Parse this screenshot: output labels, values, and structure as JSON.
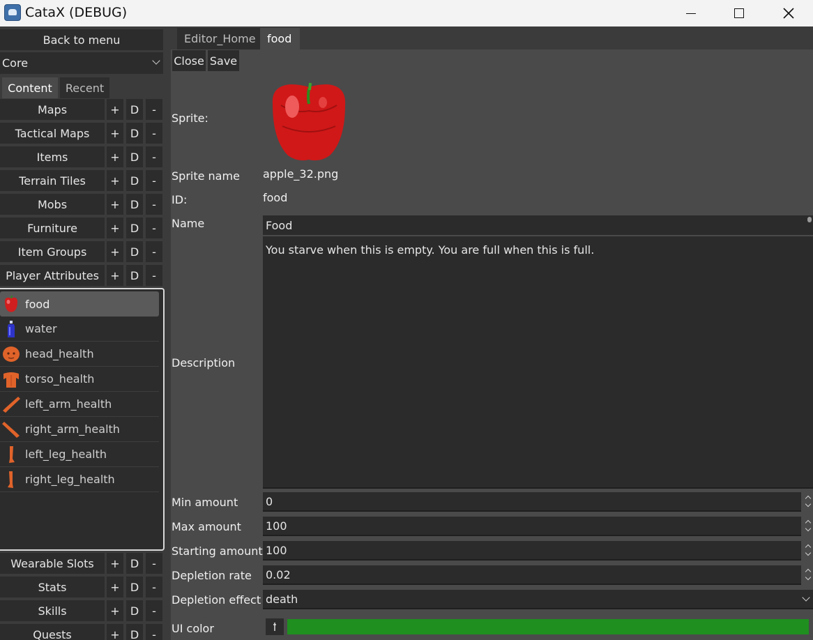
{
  "window": {
    "title": "CataX (DEBUG)"
  },
  "left": {
    "back_label": "Back to menu",
    "mod_select": "Core",
    "tabs": [
      {
        "label": "Content"
      },
      {
        "label": "Recent"
      }
    ],
    "categories_top": [
      {
        "label": "Maps"
      },
      {
        "label": "Tactical Maps"
      },
      {
        "label": "Items"
      },
      {
        "label": "Terrain Tiles"
      },
      {
        "label": "Mobs"
      },
      {
        "label": "Furniture"
      },
      {
        "label": "Item Groups"
      },
      {
        "label": "Player Attributes"
      }
    ],
    "action_labels": {
      "add": "+",
      "dup": "D",
      "del": "-"
    },
    "items": [
      {
        "label": "food",
        "icon": "apple-icon"
      },
      {
        "label": "water",
        "icon": "bottle-icon"
      },
      {
        "label": "head_health",
        "icon": "head-icon"
      },
      {
        "label": "torso_health",
        "icon": "torso-icon"
      },
      {
        "label": "left_arm_health",
        "icon": "arm-icon"
      },
      {
        "label": "right_arm_health",
        "icon": "arm-icon"
      },
      {
        "label": "left_leg_health",
        "icon": "leg-icon"
      },
      {
        "label": "right_leg_health",
        "icon": "leg-icon"
      }
    ],
    "categories_bottom": [
      {
        "label": "Wearable Slots"
      },
      {
        "label": "Stats"
      },
      {
        "label": "Skills"
      },
      {
        "label": "Quests"
      }
    ]
  },
  "editor": {
    "tabs": [
      {
        "label": "Editor_Home"
      },
      {
        "label": "food"
      }
    ],
    "close_label": "Close",
    "save_label": "Save",
    "labels": {
      "sprite": "Sprite:",
      "sprite_name": "Sprite name",
      "id": "ID:",
      "name": "Name",
      "description": "Description",
      "min_amount": "Min amount",
      "max_amount": "Max amount",
      "starting_amount": "Starting amount",
      "depletion_rate": "Depletion rate",
      "depletion_effect": "Depletion effect",
      "ui_color": "UI color"
    },
    "values": {
      "sprite_name": "apple_32.png",
      "id": "food",
      "name": "Food",
      "description": "You starve when this is empty. You are full when this is full.",
      "min_amount": "0",
      "max_amount": "100",
      "starting_amount": "100",
      "depletion_rate": "0.02",
      "depletion_effect": "death",
      "ui_color": "#1f8f1f"
    }
  }
}
